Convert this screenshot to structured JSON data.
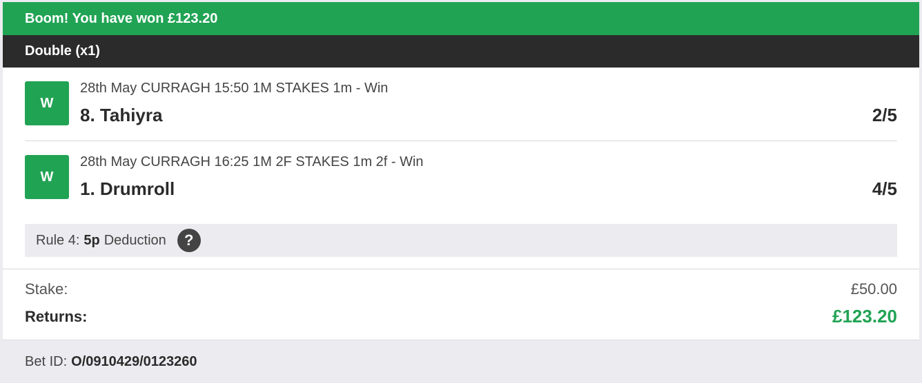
{
  "banner": {
    "text": "Boom! You have won £123.20"
  },
  "bet_type": "Double (x1)",
  "selections": [
    {
      "result_badge": "W",
      "info": "28th May CURRAGH 15:50 1M STAKES 1m - Win",
      "runner": "8. Tahiyra",
      "odds": "2/5"
    },
    {
      "result_badge": "W",
      "info": "28th May CURRAGH 16:25 1M 2F STAKES 1m 2f - Win",
      "runner": "1. Drumroll",
      "odds": "4/5"
    }
  ],
  "rule4": {
    "prefix": "Rule 4:",
    "amount": "5p",
    "suffix": "Deduction",
    "help_icon": "question-circle-icon"
  },
  "summary": {
    "stake_label": "Stake:",
    "stake_value": "£50.00",
    "returns_label": "Returns:",
    "returns_value": "£123.20"
  },
  "footer": {
    "bet_id_label": "Bet ID:",
    "bet_id_value": "O/0910429/0123260"
  },
  "colors": {
    "win_green": "#21a354",
    "dark_header": "#2b2b2b",
    "panel_grey": "#ececf0"
  }
}
